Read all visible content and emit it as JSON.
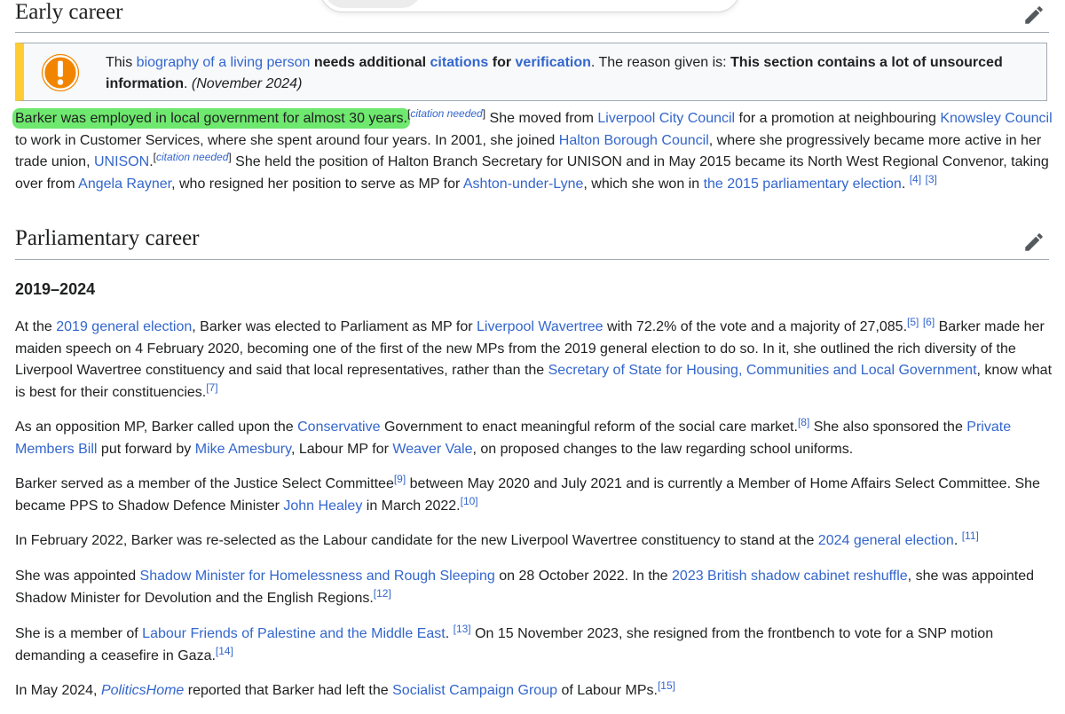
{
  "sections": {
    "early_career": {
      "title": "Early career"
    },
    "parliamentary_career": {
      "title": "Parliamentary career"
    },
    "sub_2019_2024": {
      "title": "2019–2024"
    }
  },
  "ambox": {
    "t1": "This ",
    "l1": "biography",
    "t2": " ",
    "l2": "of a living person",
    "t3": " ",
    "b1": "needs additional ",
    "l3": "citations",
    "b2": " for ",
    "l4": "verification",
    "t4": ". The reason given is: ",
    "b3": "This section contains a lot of unsourced information",
    "t5": ". ",
    "date": "(November 2024)"
  },
  "early": {
    "highlight": "Barker was employed in local government for almost 30 years.",
    "cn1": "citation needed",
    "s1": " She moved from ",
    "l_lcc": "Liverpool City Council",
    "s2": " for a promotion at neighbouring ",
    "l_knowsley": "Knowsley Council",
    "s3": " to work in Customer Services, where she spent around four years. In 2001, she joined ",
    "l_halton": "Halton Borough Council",
    "s4": ", where she progressively became more active in her trade union, ",
    "l_unison": "UNISON",
    "s5": ".",
    "cn2": "citation needed",
    "s6": " She held the position of Halton Branch Secretary for UNISON and in May 2015 became its North West Regional Convenor, taking over from ",
    "l_rayner": "Angela Rayner",
    "s7": ", who resigned her position to serve as MP for ",
    "l_ashton": "Ashton-under-Lyne",
    "s8": ", which she won in ",
    "l_2015": "the 2015 parliamentary election",
    "s9": ". ",
    "r4": "[4]",
    "r3": "[3]"
  },
  "p1": {
    "a": "At the ",
    "l_2019": "2019 general election",
    "b": ", Barker was elected to Parliament as MP for ",
    "l_lw": "Liverpool Wavertree",
    "c": " with 72.2% of the vote and a majority of 27,085.",
    "r5": "[5]",
    "r6": "[6]",
    "d": " Barker made her maiden speech on 4 February 2020, becoming one of the first of the new MPs from the 2019 general election to do so. In it, she outlined the rich diversity of the Liverpool Wavertree constituency and said that local representatives, rather than the ",
    "l_sos": "Secretary of State for Housing, Communities and Local Government",
    "e": ", know what is best for their constituencies.",
    "r7": "[7]"
  },
  "p2": {
    "a": "As an opposition MP, Barker called upon the ",
    "l_cons": "Conservative",
    "b": " Government to enact meaningful reform of the social care market.",
    "r8": "[8]",
    "c": " She also sponsored the ",
    "l_pmb": "Private Members Bill",
    "d": " put forward by ",
    "l_mike": "Mike Amesbury",
    "e": ", Labour MP for ",
    "l_wv": "Weaver Vale",
    "f": ", on proposed changes to the law regarding school uniforms."
  },
  "p3": {
    "a": "Barker served as a member of the Justice Select Committee",
    "r9": "[9]",
    "b": " between May 2020 and July 2021 and is currently a Member of Home Affairs Select Committee. She became PPS to Shadow Defence Minister ",
    "l_healey": "John Healey",
    "c": " in March 2022.",
    "r10": "[10]"
  },
  "p4": {
    "a": "In February 2022, Barker was re-selected as the Labour candidate for the new Liverpool Wavertree constituency to stand at the ",
    "l_2024": "2024 general election",
    "b": ". ",
    "r11": "[11]"
  },
  "p5": {
    "a": "She was appointed ",
    "l_shadow": "Shadow Minister for Homelessness and Rough Sleeping",
    "b": " on 28 October 2022. In the ",
    "l_reshuffle": "2023 British shadow cabinet reshuffle",
    "c": ", she was appointed Shadow Minister for Devolution and the English Regions.",
    "r12": "[12]"
  },
  "p6": {
    "a": "She is a member of ",
    "l_lfpme": "Labour Friends of Palestine and the Middle East",
    "b": ". ",
    "r13": "[13]",
    "c": " On 15 November 2023, she resigned from the frontbench to vote for a SNP motion demanding a ceasefire in Gaza.",
    "r14": "[14]"
  },
  "p7": {
    "a": "In May 2024, ",
    "l_ph": "PoliticsHome",
    "b": " reported that Barker had left the ",
    "l_scg": "Socialist Campaign Group",
    "c": " of Labour MPs.",
    "r15": "[15]"
  },
  "colors": {
    "link": "#3366cc",
    "highlight": "#6ee86e",
    "ambox_stripe": "#ffcc33",
    "warn_icon": "#f28500"
  }
}
